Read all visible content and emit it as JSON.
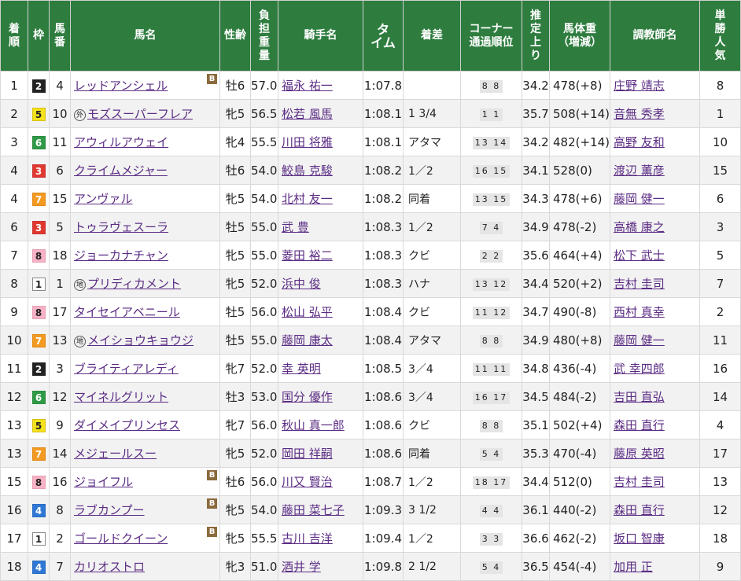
{
  "headers": {
    "rank": "着順",
    "waku": "枠",
    "umaban": "馬番",
    "horse": "馬名",
    "sexage": "性齢",
    "weight": "負担重量",
    "jockey": "騎手名",
    "time": "タイム",
    "margin": "着差",
    "corner": "コーナー通過順位",
    "last3f": "推定上り",
    "body": "馬体重(増減)",
    "trainer": "調教師名",
    "pop": "単勝人気"
  },
  "header_lines": {
    "rank": [
      "着",
      "順"
    ],
    "umaban": [
      "馬",
      "番"
    ],
    "weight": [
      "負",
      "担",
      "重",
      "量"
    ],
    "time": [
      "タ",
      "イム"
    ],
    "corner": [
      "コーナー",
      "通過順位"
    ],
    "last3f": [
      "推",
      "定",
      "上",
      "り"
    ],
    "body": [
      "馬体重",
      "（増減）"
    ],
    "pop": [
      "単",
      "勝",
      "人",
      "気"
    ]
  },
  "rows": [
    {
      "rank": "1",
      "waku": "2",
      "umaban": "4",
      "mark": "",
      "horse": "レッドアンシェル",
      "blinker": true,
      "sexage": "牡6",
      "weight": "57.0",
      "jockey": "福永 祐一",
      "time": "1:07.8",
      "margin": "",
      "corner": "8 8",
      "last3f": "34.2",
      "body": "478(+8)",
      "trainer": "庄野 靖志",
      "pop": "8"
    },
    {
      "rank": "2",
      "waku": "5",
      "umaban": "10",
      "mark": "外",
      "horse": "モズスーパーフレア",
      "blinker": false,
      "sexage": "牝5",
      "weight": "56.5",
      "jockey": "松若 風馬",
      "time": "1:08.1",
      "margin": "1 3/4",
      "corner": "1 1",
      "last3f": "35.7",
      "body": "508(+14)",
      "trainer": "音無 秀孝",
      "pop": "1"
    },
    {
      "rank": "3",
      "waku": "6",
      "umaban": "11",
      "mark": "",
      "horse": "アウィルアウェイ",
      "blinker": false,
      "sexage": "牝4",
      "weight": "55.5",
      "jockey": "川田 将雅",
      "time": "1:08.1",
      "margin": "アタマ",
      "corner": "13 14",
      "last3f": "34.2",
      "body": "482(+14)",
      "trainer": "高野 友和",
      "pop": "10"
    },
    {
      "rank": "4",
      "waku": "3",
      "umaban": "6",
      "mark": "",
      "horse": "クライムメジャー",
      "blinker": false,
      "sexage": "牡6",
      "weight": "54.0",
      "jockey": "鮫島 克駿",
      "time": "1:08.2",
      "margin": "1／2",
      "corner": "16 15",
      "last3f": "34.1",
      "body": "528(0)",
      "trainer": "渡辺 薫彦",
      "pop": "15"
    },
    {
      "rank": "4",
      "waku": "7",
      "umaban": "15",
      "mark": "",
      "horse": "アンヴァル",
      "blinker": false,
      "sexage": "牝5",
      "weight": "54.0",
      "jockey": "北村 友一",
      "time": "1:08.2",
      "margin": "同着",
      "corner": "13 15",
      "last3f": "34.3",
      "body": "478(+6)",
      "trainer": "藤岡 健一",
      "pop": "6"
    },
    {
      "rank": "6",
      "waku": "3",
      "umaban": "5",
      "mark": "",
      "horse": "トゥラヴェスーラ",
      "blinker": false,
      "sexage": "牡5",
      "weight": "55.0",
      "jockey": "武 豊",
      "time": "1:08.3",
      "margin": "1／2",
      "corner": "7 4",
      "last3f": "34.9",
      "body": "478(-2)",
      "trainer": "高橋 康之",
      "pop": "3"
    },
    {
      "rank": "7",
      "waku": "8",
      "umaban": "18",
      "mark": "",
      "horse": "ジョーカナチャン",
      "blinker": false,
      "sexage": "牝5",
      "weight": "55.0",
      "jockey": "菱田 裕二",
      "time": "1:08.3",
      "margin": "クビ",
      "corner": "2 2",
      "last3f": "35.6",
      "body": "464(+4)",
      "trainer": "松下 武士",
      "pop": "5"
    },
    {
      "rank": "8",
      "waku": "1",
      "umaban": "1",
      "mark": "地",
      "horse": "プリディカメント",
      "blinker": false,
      "sexage": "牝5",
      "weight": "52.0",
      "jockey": "浜中 俊",
      "time": "1:08.3",
      "margin": "ハナ",
      "corner": "13 12",
      "last3f": "34.4",
      "body": "520(+2)",
      "trainer": "吉村 圭司",
      "pop": "7"
    },
    {
      "rank": "9",
      "waku": "8",
      "umaban": "17",
      "mark": "",
      "horse": "タイセイアベニール",
      "blinker": false,
      "sexage": "牡5",
      "weight": "56.0",
      "jockey": "松山 弘平",
      "time": "1:08.4",
      "margin": "クビ",
      "corner": "11 12",
      "last3f": "34.7",
      "body": "490(-8)",
      "trainer": "西村 真幸",
      "pop": "2"
    },
    {
      "rank": "10",
      "waku": "7",
      "umaban": "13",
      "mark": "地",
      "horse": "メイショウキョウジ",
      "blinker": false,
      "sexage": "牡5",
      "weight": "55.0",
      "jockey": "藤岡 康太",
      "time": "1:08.4",
      "margin": "アタマ",
      "corner": "8 8",
      "last3f": "34.9",
      "body": "480(+8)",
      "trainer": "藤岡 健一",
      "pop": "11"
    },
    {
      "rank": "11",
      "waku": "2",
      "umaban": "3",
      "mark": "",
      "horse": "ブライティアレディ",
      "blinker": false,
      "sexage": "牝7",
      "weight": "52.0",
      "jockey": "幸 英明",
      "time": "1:08.5",
      "margin": "3／4",
      "corner": "11 11",
      "last3f": "34.8",
      "body": "436(-4)",
      "trainer": "武 幸四郎",
      "pop": "16"
    },
    {
      "rank": "12",
      "waku": "6",
      "umaban": "12",
      "mark": "",
      "horse": "マイネルグリット",
      "blinker": false,
      "sexage": "牡3",
      "weight": "53.0",
      "jockey": "国分 優作",
      "time": "1:08.6",
      "margin": "3／4",
      "corner": "16 17",
      "last3f": "34.5",
      "body": "484(-2)",
      "trainer": "吉田 直弘",
      "pop": "14"
    },
    {
      "rank": "13",
      "waku": "5",
      "umaban": "9",
      "mark": "",
      "horse": "ダイメイプリンセス",
      "blinker": false,
      "sexage": "牝7",
      "weight": "56.0",
      "jockey": "秋山 真一郎",
      "time": "1:08.6",
      "margin": "クビ",
      "corner": "8 8",
      "last3f": "35.1",
      "body": "502(+4)",
      "trainer": "森田 直行",
      "pop": "4"
    },
    {
      "rank": "13",
      "waku": "7",
      "umaban": "14",
      "mark": "",
      "horse": "メジェールスー",
      "blinker": false,
      "sexage": "牝5",
      "weight": "52.0",
      "jockey": "岡田 祥嗣",
      "time": "1:08.6",
      "margin": "同着",
      "corner": "5 4",
      "last3f": "35.3",
      "body": "470(-4)",
      "trainer": "藤原 英昭",
      "pop": "17"
    },
    {
      "rank": "15",
      "waku": "8",
      "umaban": "16",
      "mark": "",
      "horse": "ジョイフル",
      "blinker": true,
      "sexage": "牡6",
      "weight": "56.0",
      "jockey": "川又 賢治",
      "time": "1:08.7",
      "margin": "1／2",
      "corner": "18 17",
      "last3f": "34.4",
      "body": "512(0)",
      "trainer": "吉村 圭司",
      "pop": "13"
    },
    {
      "rank": "16",
      "waku": "4",
      "umaban": "8",
      "mark": "",
      "horse": "ラブカンプー",
      "blinker": true,
      "sexage": "牝5",
      "weight": "54.0",
      "jockey": "藤田 菜七子",
      "time": "1:09.3",
      "margin": "3 1/2",
      "corner": "4 4",
      "last3f": "36.1",
      "body": "440(-2)",
      "trainer": "森田 直行",
      "pop": "12"
    },
    {
      "rank": "17",
      "waku": "1",
      "umaban": "2",
      "mark": "",
      "horse": "ゴールドクイーン",
      "blinker": true,
      "sexage": "牝5",
      "weight": "55.5",
      "jockey": "古川 吉洋",
      "time": "1:09.4",
      "margin": "1／2",
      "corner": "3 3",
      "last3f": "36.6",
      "body": "462(-2)",
      "trainer": "坂口 智康",
      "pop": "18"
    },
    {
      "rank": "18",
      "waku": "4",
      "umaban": "7",
      "mark": "",
      "horse": "カリオストロ",
      "blinker": false,
      "sexage": "牝3",
      "weight": "51.0",
      "jockey": "酒井 学",
      "time": "1:09.8",
      "margin": "2 1/2",
      "corner": "5 4",
      "last3f": "36.5",
      "body": "454(-4)",
      "trainer": "加用 正",
      "pop": "9"
    }
  ],
  "blinker_label": "B",
  "colors": {
    "header_bg": "#2e7d3f",
    "link": "#5b2c84"
  }
}
